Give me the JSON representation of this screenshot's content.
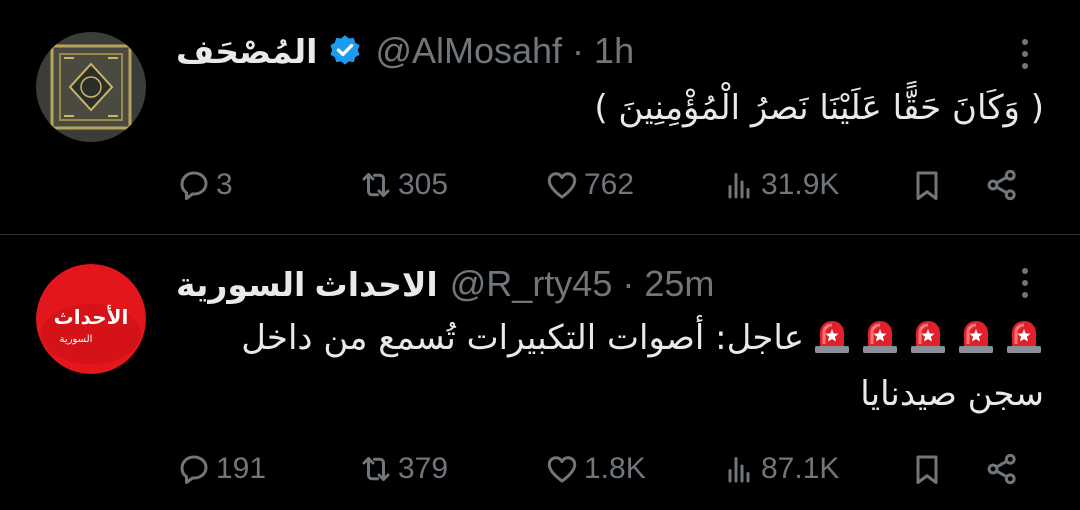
{
  "tweets": [
    {
      "display_name": "المُصْحَف",
      "verified": true,
      "handle": "@AlMosahf",
      "separator": "·",
      "time": "1h",
      "text": "( وَكَانَ حَقًّا عَلَيْنَا نَصرُ الْمُؤْمِنِينَ )",
      "stats": {
        "replies": "3",
        "retweets": "305",
        "likes": "762",
        "views": "31.9K"
      }
    },
    {
      "display_name": "الاحداث السورية",
      "verified": false,
      "handle": "@R_rty45",
      "separator": "·",
      "time": "25m",
      "text_line1": "عاجل: أصوات التكبيرات تُسمع من داخل",
      "text_line2": "سجن صيدنايا",
      "emoji": "rotating-light",
      "emoji_count": 5,
      "avatar_text": "الأحداث",
      "avatar_subtext": "السورية",
      "stats": {
        "replies": "191",
        "retweets": "379",
        "likes": "1.8K",
        "views": "87.1K"
      }
    }
  ],
  "colors": {
    "background": "#000000",
    "text": "#e7e9ea",
    "muted": "#71767b",
    "verified_blue": "#1d9bf0",
    "divider": "#2f3336",
    "avatar_red": "#e3161b"
  },
  "icons": [
    "reply-icon",
    "retweet-icon",
    "like-icon",
    "views-icon",
    "bookmark-icon",
    "share-icon",
    "more-icon",
    "verified-icon",
    "siren-icon"
  ]
}
